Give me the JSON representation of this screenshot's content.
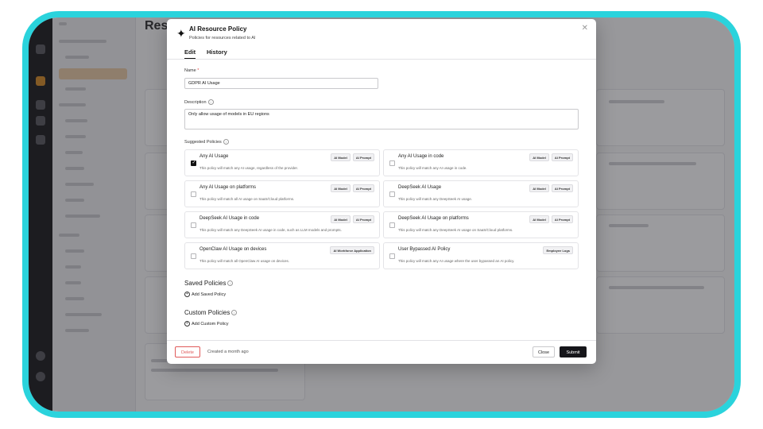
{
  "background_page": {
    "title": "Reso"
  },
  "modal": {
    "title": "AI Resource Policy",
    "subtitle": "Policies for resources related to AI",
    "tabs": [
      {
        "label": "Edit",
        "active": true
      },
      {
        "label": "History",
        "active": false
      }
    ],
    "name_label": "Name",
    "name_required": "*",
    "name_value": "GDPR AI Usage",
    "description_label": "Description",
    "description_value": "Only allow usage of models in EU regions",
    "suggested_label": "Suggested Policies",
    "policies": [
      {
        "title": "Any AI Usage",
        "desc": "This policy will match any AI usage, regardless of the provider.",
        "tags": [
          "AI Model",
          "AI Prompt"
        ],
        "checked": true
      },
      {
        "title": "Any AI Usage in code",
        "desc": "This policy will match any AI usage in code.",
        "tags": [
          "AI Model",
          "AI Prompt"
        ],
        "checked": false
      },
      {
        "title": "Any AI Usage on platforms",
        "desc": "This policy will match all AI usage on SaaS/Cloud platforms.",
        "tags": [
          "AI Model",
          "AI Prompt"
        ],
        "checked": false
      },
      {
        "title": "DeepSeek AI Usage",
        "desc": "This policy will match any DeepSeek AI usage.",
        "tags": [
          "AI Model",
          "AI Prompt"
        ],
        "checked": false
      },
      {
        "title": "DeepSeek AI Usage in code",
        "desc": "This policy will match any DeepSeek AI usage in code, such as LLM models and prompts.",
        "tags": [
          "AI Model",
          "AI Prompt"
        ],
        "checked": false
      },
      {
        "title": "DeepSeek AI Usage on platforms",
        "desc": "This policy will match any DeepSeek AI usage on SaaS/Cloud platforms.",
        "tags": [
          "AI Model",
          "AI Prompt"
        ],
        "checked": false
      },
      {
        "title": "OpenClaw AI Usage on devices",
        "desc": "This policy will match all OpenClaw AI usage on devices.",
        "tags": [
          "AI Workforce Application"
        ],
        "checked": false
      },
      {
        "title": "User Bypassed AI Policy",
        "desc": "This policy will match any AI usage where the user bypassed an AI policy.",
        "tags": [
          "Employee Logs"
        ],
        "checked": false
      }
    ],
    "saved_policies_title": "Saved Policies",
    "add_saved_label": "Add Saved Policy",
    "custom_policies_title": "Custom Policies",
    "add_custom_label": "Add Custom Policy",
    "footer": {
      "delete_label": "Delete",
      "created_text": "Created a month ago",
      "close_label": "Close",
      "submit_label": "Submit"
    }
  },
  "colors": {
    "frame": "#2ad3dc",
    "delete": "#e05a5a",
    "submit_bg": "#16161a",
    "sidebar_highlight": "#e6c9a4"
  }
}
